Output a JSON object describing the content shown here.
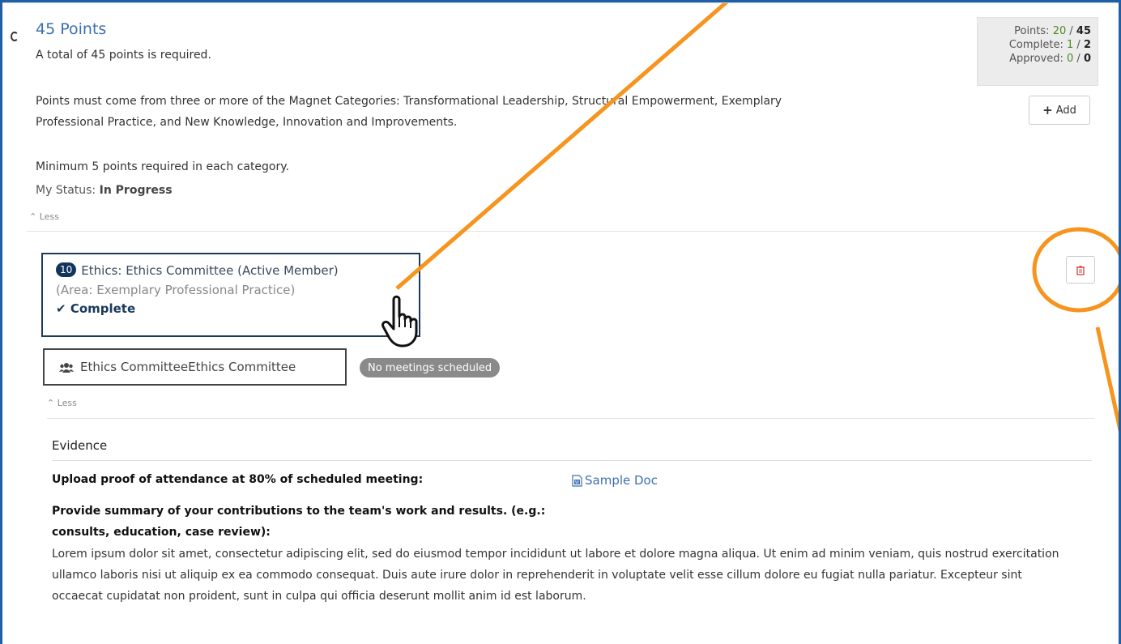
{
  "requirement": {
    "title": "45 Points",
    "subtitle": "A total of 45 points is required.",
    "description": "Points must come from three or more of the Magnet Categories: Transformational Leadership, Structural Empowerment, Exemplary Professional Practice, and New Knowledge, Innovation and Improvements.",
    "minimum": "Minimum 5 points required in each category.",
    "status_label": "My Status:",
    "status_value": "In Progress",
    "less_label": "Less"
  },
  "summary": {
    "points_label": "Points:",
    "points_value": "20",
    "points_total": "45",
    "complete_label": "Complete:",
    "complete_value": "1",
    "complete_total": "2",
    "approved_label": "Approved:",
    "approved_value": "0",
    "approved_total": "0",
    "separator": "/"
  },
  "toolbar": {
    "add_label": "Add",
    "delete_icon": "trash-icon"
  },
  "activity": {
    "points_badge": "10",
    "title": "Ethics: Ethics Committee (Active Member)",
    "area": "(Area: Exemplary Professional Practice)",
    "status": "Complete"
  },
  "committee": {
    "icon": "group-icon",
    "label": "Ethics CommitteeEthics Committee",
    "meetings": "No meetings scheduled",
    "less_label": "Less"
  },
  "evidence": {
    "heading": "Evidence",
    "question_1": "Upload proof of attendance at 80% of scheduled meeting:",
    "sample_doc": "Sample Doc",
    "question_2": "Provide summary of your contributions to the team's work and results. (e.g.: consults, education, case review):",
    "answer_2": "Lorem ipsum dolor sit amet, consectetur adipiscing elit, sed do eiusmod tempor incididunt ut labore et dolore magna aliqua. Ut enim ad minim veniam, quis nostrud exercitation ullamco laboris nisi ut aliquip ex ea commodo consequat. Duis aute irure dolor in reprehenderit in voluptate velit esse cillum dolore eu fugiat nulla pariatur. Excepteur sint occaecat cupidatat non proident, sunt in culpa qui officia deserunt mollit anim id est laborum."
  },
  "colors": {
    "annotation": "#f7941d",
    "link": "#3c6fb0",
    "points_green": "#4a8a23",
    "badge_navy": "#12355b",
    "delete_red": "#d9534f"
  }
}
